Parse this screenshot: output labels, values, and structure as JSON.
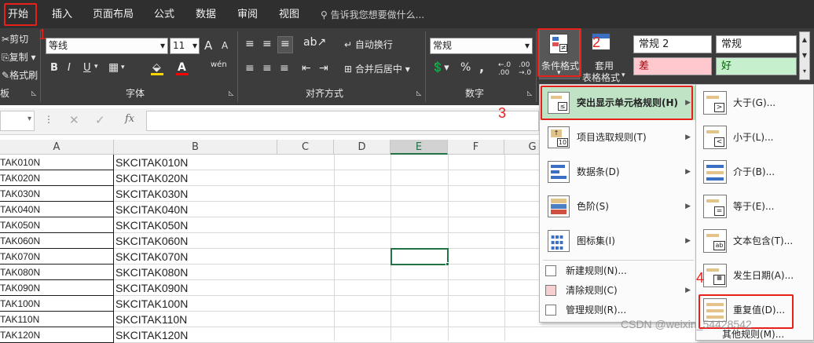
{
  "tabs": [
    "开始",
    "插入",
    "页面布局",
    "公式",
    "数据",
    "审阅",
    "视图"
  ],
  "search_placeholder": "告诉我您想要做什么...",
  "clipboard": {
    "cut": "剪切",
    "copy": "复制",
    "format_painter": "格式刷",
    "group_label": "板"
  },
  "font": {
    "name": "等线",
    "size": "11",
    "group_label": "字体",
    "bold": "B",
    "italic": "I",
    "underline": "U",
    "grow": "A",
    "shrink": "A",
    "phonetic": "wén"
  },
  "alignment": {
    "wrap": "自动换行",
    "merge": "合并后居中",
    "group_label": "对齐方式"
  },
  "number": {
    "format": "常规",
    "group_label": "数字",
    "percent": "%",
    "comma": ","
  },
  "styles": {
    "cond_format": "条件格式",
    "table_format_1": "套用",
    "table_format_2": "表格格式",
    "normal2": "常规 2",
    "normal": "常规",
    "bad": "差",
    "good": "好"
  },
  "formula_bar": {
    "fx": "fx"
  },
  "columns": [
    "A",
    "B",
    "C",
    "D",
    "E",
    "F",
    "G"
  ],
  "rows": [
    {
      "a": "TAK010N",
      "b": "SKCITAK010N"
    },
    {
      "a": "TAK020N",
      "b": "SKCITAK020N"
    },
    {
      "a": "TAK030N",
      "b": "SKCITAK030N"
    },
    {
      "a": "TAK040N",
      "b": "SKCITAK040N"
    },
    {
      "a": "TAK050N",
      "b": "SKCITAK050N"
    },
    {
      "a": "TAK060N",
      "b": "SKCITAK060N"
    },
    {
      "a": "TAK070N",
      "b": "SKCITAK070N"
    },
    {
      "a": "TAK080N",
      "b": "SKCITAK080N"
    },
    {
      "a": "TAK090N",
      "b": "SKCITAK090N"
    },
    {
      "a": "TAK100N",
      "b": "SKCITAK100N"
    },
    {
      "a": "TAK110N",
      "b": "SKCITAK110N"
    },
    {
      "a": "TAK120N",
      "b": "SKCITAK120N"
    }
  ],
  "menu": {
    "highlight_rules": "突出显示单元格规则(H)",
    "top_bottom": "项目选取规则(T)",
    "data_bars": "数据条(D)",
    "color_scales": "色阶(S)",
    "icon_sets": "图标集(I)",
    "new_rule": "新建规则(N)...",
    "clear_rules": "清除规则(C)",
    "manage_rules": "管理规则(R)..."
  },
  "submenu": {
    "greater": "大于(G)...",
    "less": "小于(L)...",
    "between": "介于(B)...",
    "equal": "等于(E)...",
    "text_contains": "文本包含(T)...",
    "date_occurring": "发生日期(A)...",
    "duplicate": "重复值(D)...",
    "more_rules": "其他规则(M)..."
  },
  "annotations": [
    "1",
    "2",
    "3",
    "4"
  ],
  "watermark": "CSDN @weixin_54428542",
  "colors": {
    "accent_red": "#e8201c",
    "highlight_green": "#bfe3c4",
    "bad_fill": "#ffc7ce",
    "good_fill": "#c6efce",
    "selected_col": "#217346"
  }
}
